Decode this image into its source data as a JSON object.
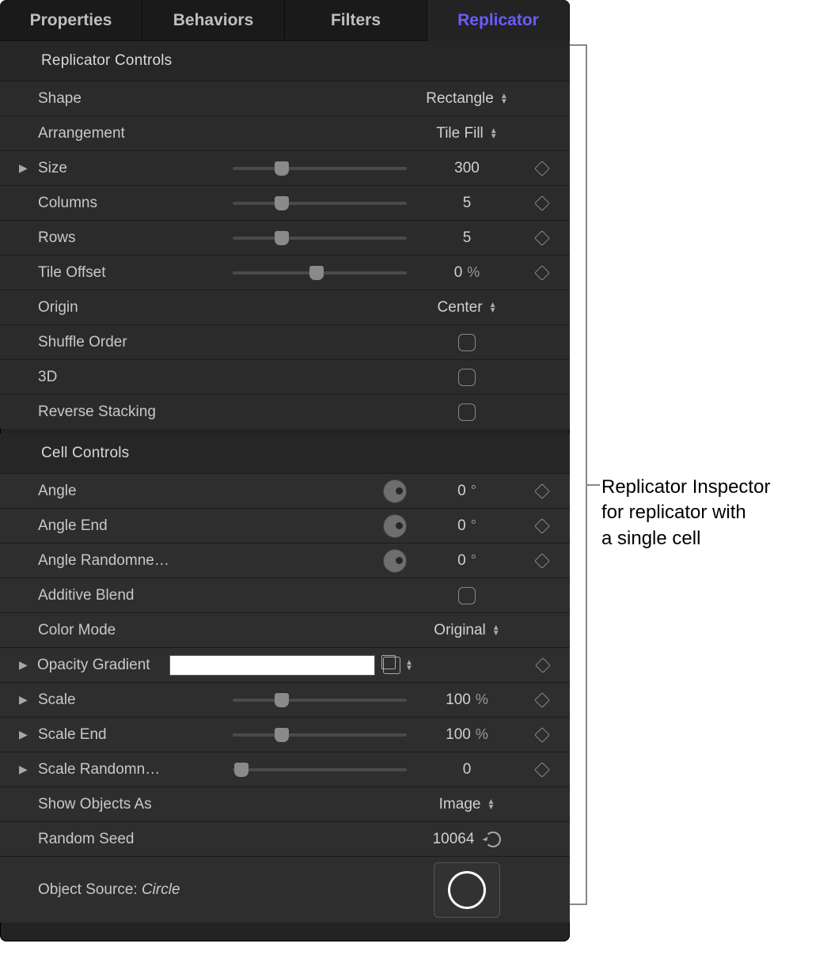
{
  "tabs": {
    "properties": "Properties",
    "behaviors": "Behaviors",
    "filters": "Filters",
    "replicator": "Replicator"
  },
  "sections": {
    "replicator_controls": "Replicator Controls",
    "cell_controls": "Cell Controls"
  },
  "rc": {
    "shape": {
      "label": "Shape",
      "value": "Rectangle"
    },
    "arrangement": {
      "label": "Arrangement",
      "value": "Tile Fill"
    },
    "size": {
      "label": "Size",
      "value": "300",
      "pos": 28
    },
    "columns": {
      "label": "Columns",
      "value": "5",
      "pos": 28
    },
    "rows": {
      "label": "Rows",
      "value": "5",
      "pos": 28
    },
    "tile_offset": {
      "label": "Tile Offset",
      "value": "0",
      "unit": "%",
      "pos": 48
    },
    "origin": {
      "label": "Origin",
      "value": "Center"
    },
    "shuffle": {
      "label": "Shuffle Order"
    },
    "threeD": {
      "label": "3D"
    },
    "reverse": {
      "label": "Reverse Stacking"
    }
  },
  "cc": {
    "angle": {
      "label": "Angle",
      "value": "0",
      "unit": "°"
    },
    "angle_end": {
      "label": "Angle End",
      "value": "0",
      "unit": "°"
    },
    "angle_rand": {
      "label": "Angle Randomne…",
      "value": "0",
      "unit": "°"
    },
    "additive": {
      "label": "Additive Blend"
    },
    "color_mode": {
      "label": "Color Mode",
      "value": "Original"
    },
    "opacity_gradient": {
      "label": "Opacity Gradient"
    },
    "scale": {
      "label": "Scale",
      "value": "100",
      "unit": "%",
      "pos": 28
    },
    "scale_end": {
      "label": "Scale End",
      "value": "100",
      "unit": "%",
      "pos": 28
    },
    "scale_rand": {
      "label": "Scale Randomn…",
      "value": "0",
      "pos": 5
    },
    "show_objects": {
      "label": "Show Objects As",
      "value": "Image"
    },
    "random_seed": {
      "label": "Random Seed",
      "value": "10064"
    },
    "object_source": {
      "label_prefix": "Object Source: ",
      "label_value": "Circle"
    }
  },
  "callout": {
    "line1": "Replicator Inspector",
    "line2": "for replicator with",
    "line3": "a single cell"
  }
}
